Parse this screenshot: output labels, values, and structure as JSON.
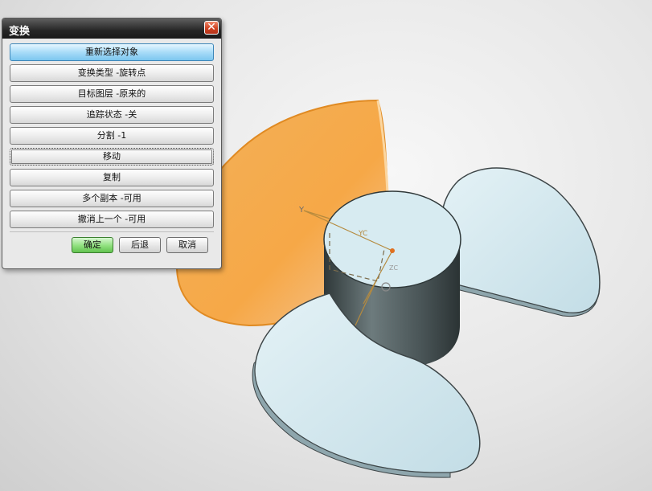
{
  "dialog": {
    "title": "变换",
    "close_label": "✕",
    "menu": [
      {
        "label": "重新选择对象"
      },
      {
        "label": "变换类型 -旋转点"
      },
      {
        "label": "目标图层 -原来的"
      },
      {
        "label": "追踪状态 -关"
      },
      {
        "label": "分割 -1"
      },
      {
        "label": "移动"
      },
      {
        "label": "复制"
      },
      {
        "label": "多个副本 -可用"
      },
      {
        "label": "撤消上一个 -可用"
      }
    ],
    "ok_label": "确定",
    "back_label": "后退",
    "cancel_label": "取消"
  },
  "viewport": {
    "axis_y_label": "Y",
    "axis_yc_label": "YC",
    "axis_zc_label": "ZC",
    "colors": {
      "selected_blade": "#f5a94a",
      "blade": "#d2e8ef",
      "hub_side": "#4a5658",
      "background": "#e6e6e6"
    }
  }
}
